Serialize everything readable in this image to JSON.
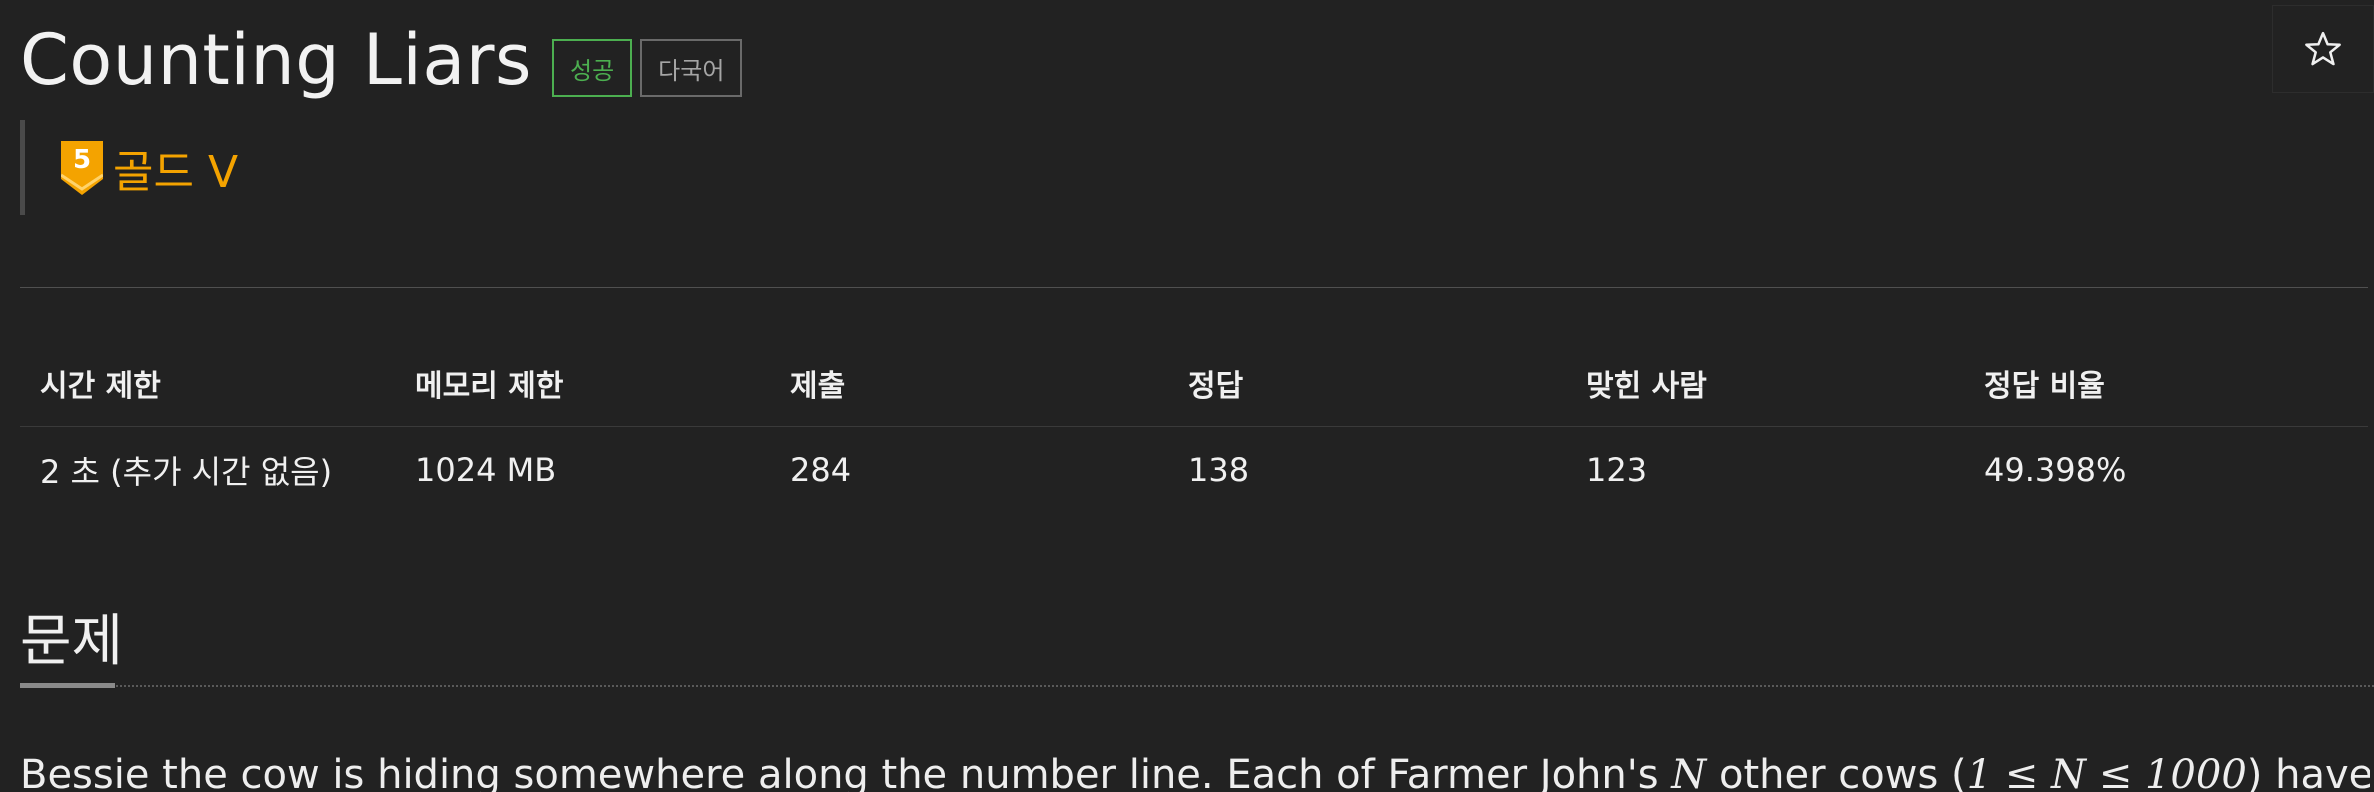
{
  "header": {
    "title": "Counting Liars",
    "badges": {
      "success": "성공",
      "multilang": "다국어"
    },
    "star_icon": "star-outline-icon"
  },
  "tier": {
    "number": "5",
    "label": "골드 V",
    "color": "#f4a300"
  },
  "info_table": {
    "headers": [
      "시간 제한",
      "메모리 제한",
      "제출",
      "정답",
      "맞힌 사람",
      "정답 비율"
    ],
    "values": [
      "2 초 (추가 시간 없음)",
      "1024 MB",
      "284",
      "138",
      "123",
      "49.398%"
    ]
  },
  "section": {
    "title": "문제"
  },
  "problem": {
    "line_start": "Bessie the cow is hiding somewhere along the number line. Each of Farmer John's ",
    "var_n": "N",
    "mid": " other cows (",
    "math_range": "1 ≤ N ≤ 1000",
    "line_end": ") have a piece"
  },
  "colors": {
    "background": "#222222",
    "success_badge": "#4caf50",
    "tier_gold": "#f4a300"
  }
}
